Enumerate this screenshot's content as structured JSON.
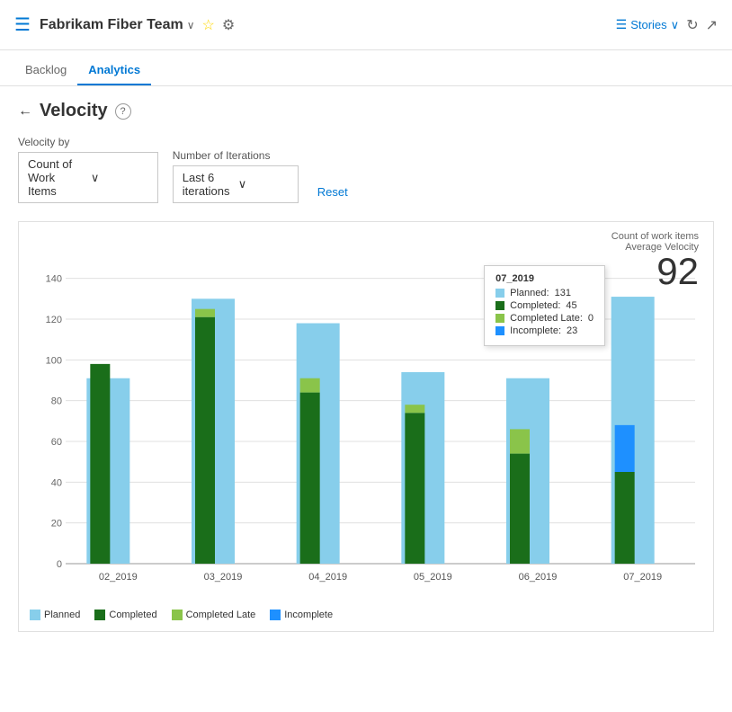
{
  "header": {
    "icon": "☰",
    "team_name": "Fabrikam Fiber Team",
    "chevron": "∨",
    "star": "☆",
    "people": "👥",
    "right": {
      "stories_icon": "☰",
      "stories_label": "Stories",
      "stories_chevron": "∨",
      "refresh_label": "↻",
      "expand_label": "↗"
    }
  },
  "nav": {
    "tabs": [
      {
        "label": "Backlog",
        "active": false
      },
      {
        "label": "Analytics",
        "active": true
      }
    ]
  },
  "page": {
    "back_icon": "←",
    "title": "Velocity",
    "help_icon": "?"
  },
  "filters": {
    "velocity_by_label": "Velocity by",
    "velocity_by_value": "Count of Work Items",
    "iterations_label": "Number of Iterations",
    "iterations_value": "Last 6 iterations",
    "reset_label": "Reset"
  },
  "chart": {
    "meta_label": "Count of work items",
    "meta_sublabel": "Average Velocity",
    "meta_value": "92",
    "tooltip": {
      "title": "07_2019",
      "planned_label": "Planned:",
      "planned_value": "131",
      "completed_label": "Completed:",
      "completed_value": "45",
      "completed_late_label": "Completed Late:",
      "completed_late_value": "0",
      "incomplete_label": "Incomplete:",
      "incomplete_value": "23"
    },
    "y_axis": [
      0,
      20,
      40,
      60,
      80,
      100,
      120,
      140
    ],
    "bars": [
      {
        "label": "02_2019",
        "planned": 91,
        "completed": 98,
        "completed_late": 0,
        "incomplete": 0
      },
      {
        "label": "03_2019",
        "planned": 130,
        "completed": 121,
        "completed_late": 4,
        "incomplete": 0
      },
      {
        "label": "04_2019",
        "planned": 118,
        "completed": 84,
        "completed_late": 7,
        "incomplete": 0
      },
      {
        "label": "05_2019",
        "planned": 94,
        "completed": 74,
        "completed_late": 4,
        "incomplete": 0
      },
      {
        "label": "06_2019",
        "planned": 91,
        "completed": 54,
        "completed_late": 12,
        "incomplete": 0
      },
      {
        "label": "07_2019",
        "planned": 131,
        "completed": 45,
        "completed_late": 0,
        "incomplete": 23
      }
    ],
    "colors": {
      "planned": "#87CEEB",
      "completed": "#1a6e1a",
      "completed_late": "#8ac44a",
      "incomplete": "#1e90ff"
    },
    "legend": [
      {
        "label": "Planned",
        "color": "#87CEEB"
      },
      {
        "label": "Completed",
        "color": "#1a6e1a"
      },
      {
        "label": "Completed Late",
        "color": "#8ac44a"
      },
      {
        "label": "Incomplete",
        "color": "#1e90ff"
      }
    ]
  }
}
